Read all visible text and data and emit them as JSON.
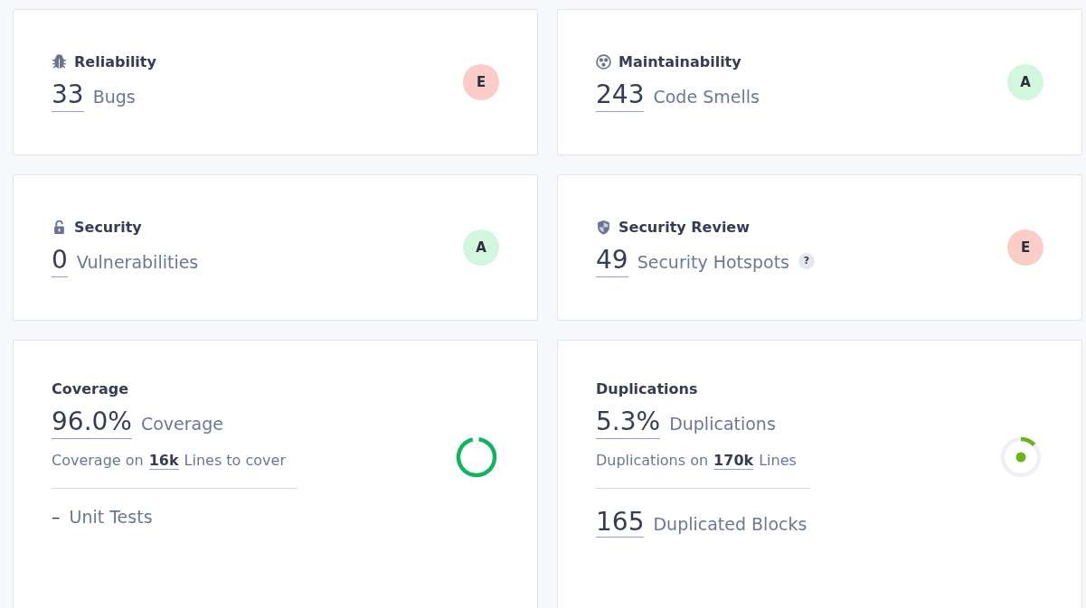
{
  "cards": [
    {
      "kind": "rating",
      "title": "Reliability",
      "value": "33",
      "label": "Bugs",
      "rating": "E",
      "color": "#fbcdc8"
    },
    {
      "kind": "rating",
      "title": "Maintainability",
      "value": "243",
      "label": "Code Smells",
      "rating": "A",
      "color": "#d3f6de"
    },
    {
      "kind": "rating",
      "title": "Security",
      "value": "0",
      "label": "Vulnerabilities",
      "rating": "A",
      "color": "#d3f6de"
    },
    {
      "kind": "rating",
      "title": "Security Review",
      "value": "49",
      "label": "Security Hotspots",
      "help": "?",
      "rating": "E",
      "color": "#fbcdc8"
    },
    {
      "kind": "coverage",
      "title": "Coverage",
      "value": "96.0%",
      "label": "Coverage",
      "detail_prefix": "Coverage on",
      "detail_value": "16k",
      "detail_suffix": "Lines to cover",
      "extra_value": "–",
      "extra_label": "Unit Tests",
      "extra_underlined": false
    },
    {
      "kind": "duplication",
      "title": "Duplications",
      "value": "5.3%",
      "label": "Duplications",
      "detail_prefix": "Duplications on",
      "detail_value": "170k",
      "detail_suffix": "Lines",
      "extra_value": "165",
      "extra_label": "Duplicated Blocks",
      "extra_underlined": true
    }
  ]
}
